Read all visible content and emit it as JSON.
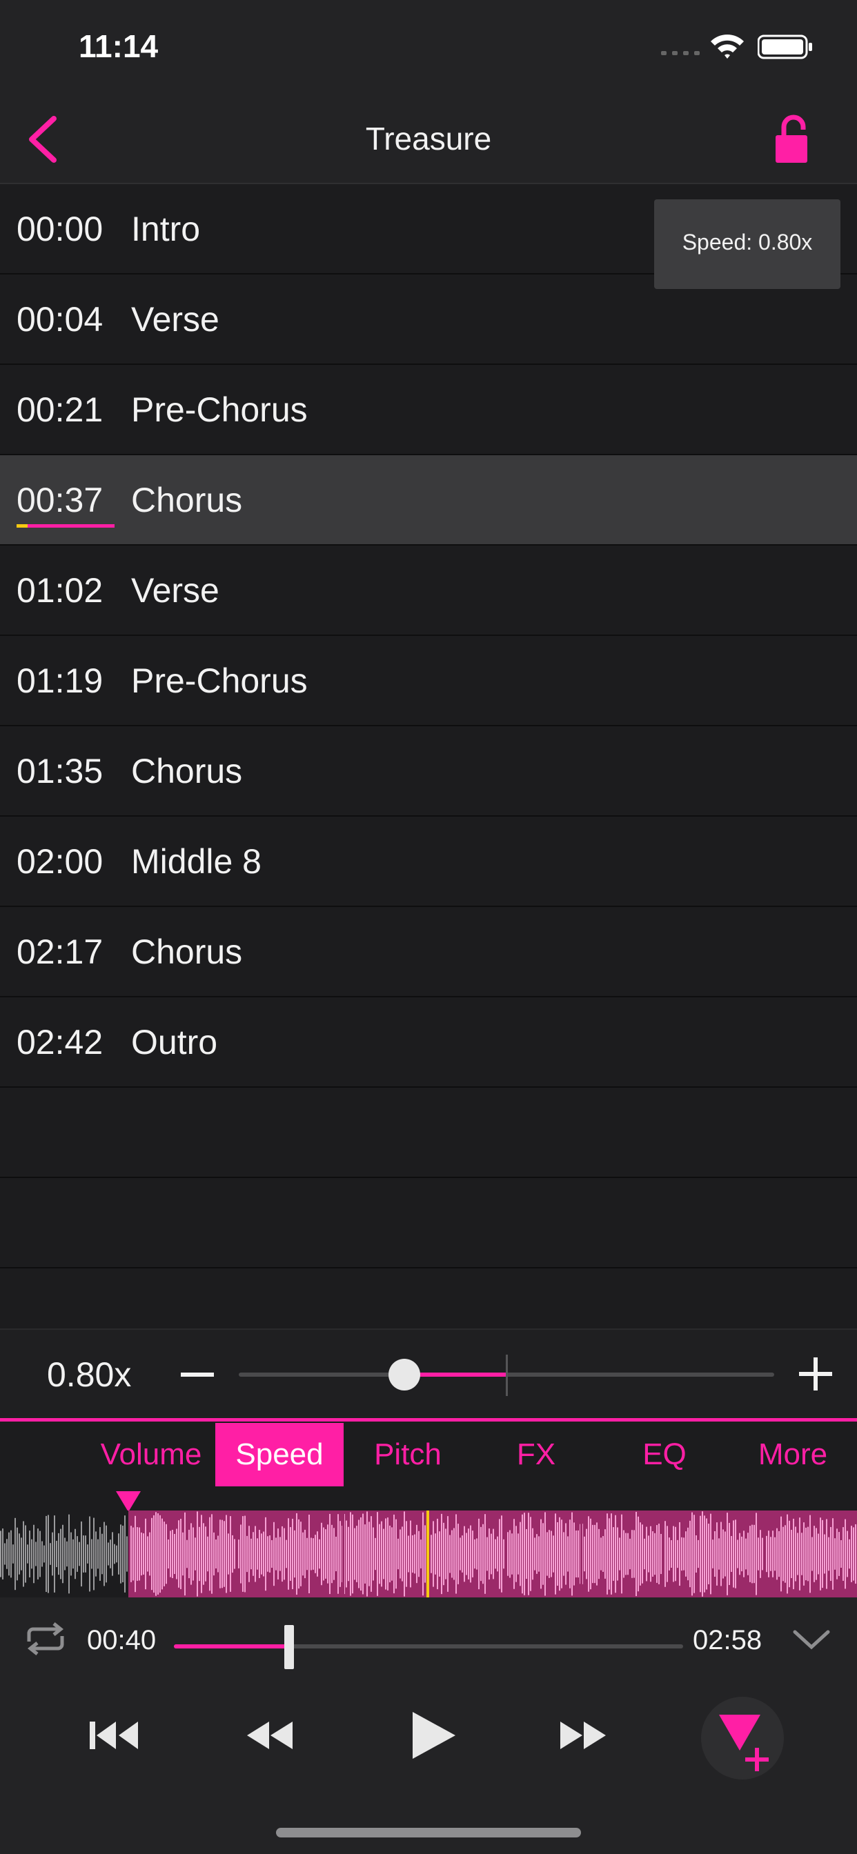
{
  "status_bar": {
    "time": "11:14"
  },
  "nav": {
    "title": "Treasure",
    "back_icon": "chevron-left-icon",
    "lock_icon": "unlock-icon"
  },
  "colors": {
    "accent": "#ff1fa5",
    "waveform_light": "#f7a0d4",
    "waveform_dark": "#9b2a69",
    "playhead": "#f6c912",
    "background": "#1c1c1e"
  },
  "sections": [
    {
      "time": "00:00",
      "name": "Intro"
    },
    {
      "time": "00:04",
      "name": "Verse"
    },
    {
      "time": "00:21",
      "name": "Pre-Chorus"
    },
    {
      "time": "00:37",
      "name": "Chorus",
      "selected": true
    },
    {
      "time": "01:02",
      "name": "Verse"
    },
    {
      "time": "01:19",
      "name": "Pre-Chorus"
    },
    {
      "time": "01:35",
      "name": "Chorus"
    },
    {
      "time": "02:00",
      "name": "Middle 8"
    },
    {
      "time": "02:17",
      "name": "Chorus"
    },
    {
      "time": "02:42",
      "name": "Outro"
    }
  ],
  "tooltip": {
    "text": "Speed: 0.80x"
  },
  "speed_control": {
    "value_label": "0.80x",
    "value": 0.8
  },
  "tabs": [
    {
      "label": "Volume"
    },
    {
      "label": "Speed",
      "active": true
    },
    {
      "label": "Pitch"
    },
    {
      "label": "FX"
    },
    {
      "label": "EQ"
    },
    {
      "label": "More"
    }
  ],
  "playback": {
    "current_time": "00:40",
    "total_time": "02:58",
    "progress": 0.225
  }
}
